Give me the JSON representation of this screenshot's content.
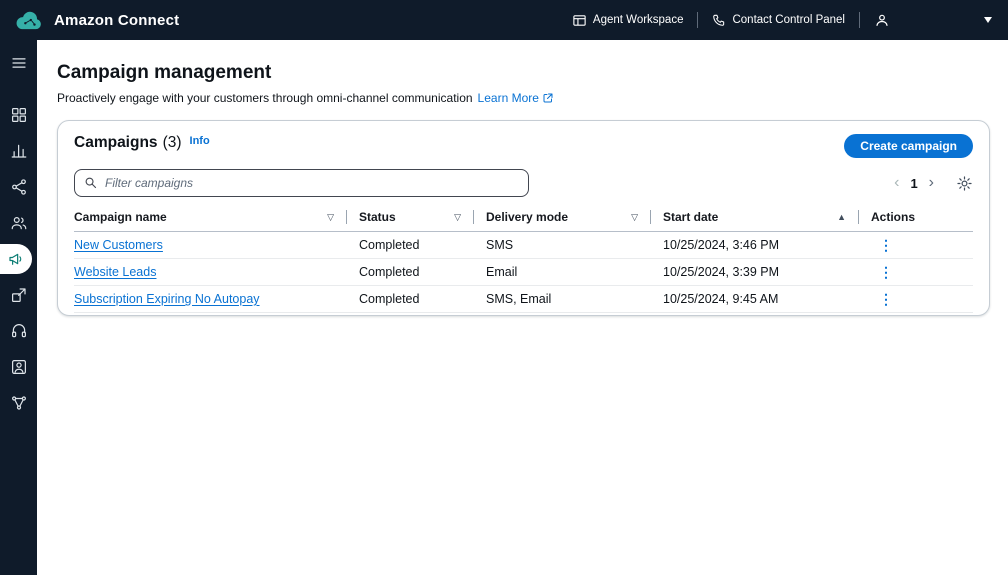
{
  "colors": {
    "topbar_bg": "#0f1b2a",
    "accent_blue": "#0972d3",
    "brand_teal": "#35b0a8",
    "active_icon_teal": "#0b7d74"
  },
  "topbar": {
    "brand": "Amazon Connect",
    "agent_workspace": "Agent Workspace",
    "contact_control_panel": "Contact Control Panel"
  },
  "page": {
    "title": "Campaign management",
    "subtitle": "Proactively engage with your customers through omni-channel communication",
    "learn_more": "Learn More"
  },
  "campaigns": {
    "title": "Campaigns",
    "count": "(3)",
    "info": "Info",
    "create_button": "Create campaign",
    "filter_placeholder": "Filter campaigns",
    "pagination": {
      "prev": "‹",
      "page": "1",
      "next": "›"
    },
    "table": {
      "columns": [
        {
          "label": "Campaign name",
          "sort": "▽"
        },
        {
          "label": "Status",
          "sort": "▽"
        },
        {
          "label": "Delivery mode",
          "sort": "▽"
        },
        {
          "label": "Start date",
          "sort": "▲"
        },
        {
          "label": "Actions",
          "sort": ""
        }
      ],
      "actions_icon": "⋮",
      "rows": [
        {
          "name": "New Customers",
          "status": "Completed",
          "delivery_mode": "SMS",
          "start_date": "10/25/2024, 3:46 PM"
        },
        {
          "name": "Website Leads",
          "status": "Completed",
          "delivery_mode": "Email",
          "start_date": "10/25/2024, 3:39 PM"
        },
        {
          "name": "Subscription Expiring No Autopay",
          "status": "Completed",
          "delivery_mode": "SMS, Email",
          "start_date": "10/25/2024, 9:45 AM"
        }
      ]
    }
  }
}
